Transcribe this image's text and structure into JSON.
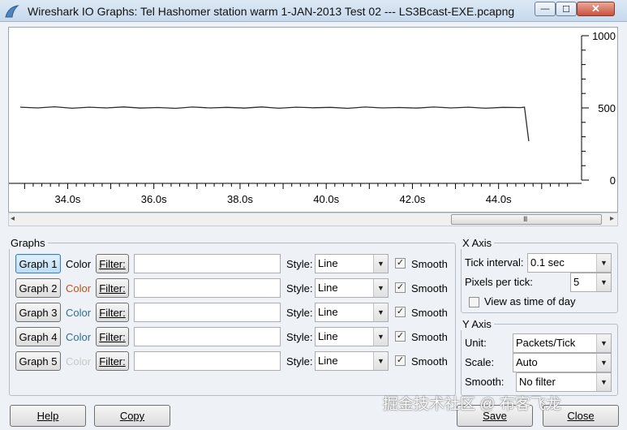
{
  "window": {
    "title": "Wireshark IO Graphs: Tel Hashomer station warm 1-JAN-2013 Test 02 --- LS3Bcast-EXE.pcapng",
    "min_icon": "minimize-icon",
    "max_icon": "maximize-icon",
    "close_icon": "close-icon",
    "min_glyph": "—",
    "max_glyph": "☐",
    "close_glyph": "✕"
  },
  "chart_data": {
    "type": "line",
    "x_tick_labels": [
      "34.0s",
      "36.0s",
      "38.0s",
      "40.0s",
      "42.0s",
      "44.0s"
    ],
    "x_ticks": [
      34,
      36,
      38,
      40,
      42,
      44
    ],
    "xlim": [
      32.9,
      45.7
    ],
    "y_tick_labels": [
      "1000",
      "500",
      "0"
    ],
    "y_ticks": [
      1000,
      500,
      0
    ],
    "ylim": [
      0,
      1000
    ],
    "series": [
      {
        "color": "#2b2b2b",
        "x": [
          32.9,
          33.3,
          33.7,
          34.1,
          34.5,
          34.9,
          35.3,
          35.7,
          36.1,
          36.5,
          36.9,
          37.3,
          37.7,
          38.1,
          38.5,
          38.9,
          39.3,
          39.7,
          40.1,
          40.5,
          40.9,
          41.3,
          41.7,
          42.1,
          42.5,
          42.9,
          43.3,
          43.7,
          44.1,
          44.5,
          44.6,
          44.7
        ],
        "values": [
          505,
          500,
          508,
          498,
          505,
          500,
          507,
          499,
          503,
          497,
          506,
          500,
          504,
          499,
          507,
          498,
          505,
          501,
          504,
          497,
          506,
          500,
          503,
          499,
          506,
          500,
          505,
          498,
          504,
          502,
          505,
          270
        ]
      }
    ]
  },
  "scrollbar": {
    "left_arrow": "◂",
    "right_arrow": "▸",
    "grip": "III"
  },
  "graphs": {
    "legend": "Graphs",
    "rows": [
      {
        "button": "Graph 1",
        "color_label": "Color",
        "color": "#000000",
        "filter_button": "Filter:",
        "filter_value": "",
        "style_label": "Style:",
        "style": "Line",
        "smooth_label": "Smooth",
        "smooth_checked": true
      },
      {
        "button": "Graph 2",
        "color_label": "Color",
        "color": "#c0501a",
        "filter_button": "Filter:",
        "filter_value": "",
        "style_label": "Style:",
        "style": "Line",
        "smooth_label": "Smooth",
        "smooth_checked": true
      },
      {
        "button": "Graph 3",
        "color_label": "Color",
        "color": "#2f6f90",
        "filter_button": "Filter:",
        "filter_value": "",
        "style_label": "Style:",
        "style": "Line",
        "smooth_label": "Smooth",
        "smooth_checked": true
      },
      {
        "button": "Graph 4",
        "color_label": "Color",
        "color": "#2f6f90",
        "filter_button": "Filter:",
        "filter_value": "",
        "style_label": "Style:",
        "style": "Line",
        "smooth_label": "Smooth",
        "smooth_checked": true
      },
      {
        "button": "Graph 5",
        "color_label": "Color",
        "color": "#c8c8c8",
        "filter_button": "Filter:",
        "filter_value": "",
        "style_label": "Style:",
        "style": "Line",
        "smooth_label": "Smooth",
        "smooth_checked": true
      }
    ]
  },
  "x_axis": {
    "legend": "X Axis",
    "tick_interval_label": "Tick interval:",
    "tick_interval": "0.1 sec",
    "pixels_per_tick_label": "Pixels per tick:",
    "pixels_per_tick": "5",
    "time_of_day_label": "View as time of day",
    "time_of_day_checked": false
  },
  "y_axis": {
    "legend": "Y Axis",
    "unit_label": "Unit:",
    "unit": "Packets/Tick",
    "scale_label": "Scale:",
    "scale": "Auto",
    "smooth_label": "Smooth:",
    "smooth": "No filter"
  },
  "buttons": {
    "help": "Help",
    "copy": "Copy",
    "save": "Save",
    "close": "Close"
  },
  "dropdown_icon": "▼",
  "check_glyph": "✓",
  "watermark": "掘金技术社区 @ 布客飞龙"
}
